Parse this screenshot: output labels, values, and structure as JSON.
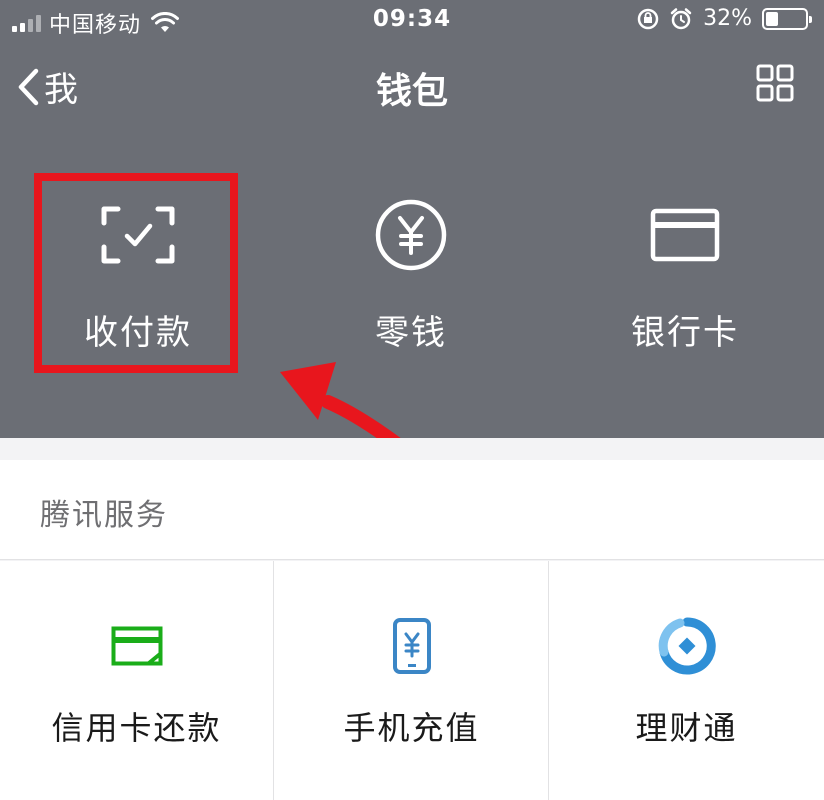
{
  "status_bar": {
    "carrier": "中国移动",
    "time": "09:34",
    "battery_percent": "32%",
    "battery_level": 0.32,
    "signal_bars": 4,
    "signal_bars_active": 2
  },
  "navbar": {
    "back_label": "我",
    "title": "钱包"
  },
  "wallet": {
    "items": [
      {
        "label": "收付款",
        "icon": "scan-check-icon"
      },
      {
        "label": "零钱",
        "icon": "yuan-coin-icon"
      },
      {
        "label": "银行卡",
        "icon": "bank-card-icon"
      }
    ]
  },
  "tencent_services": {
    "title": "腾讯服务",
    "items": [
      {
        "label": "信用卡还款",
        "icon": "credit-card-icon",
        "color": "#1aad19"
      },
      {
        "label": "手机充值",
        "icon": "phone-recharge-icon",
        "color": "#3b86c6"
      },
      {
        "label": "理财通",
        "icon": "wealth-icon",
        "color": "#2f8fd6"
      }
    ]
  },
  "colors": {
    "header_bg": "#6b6e75",
    "highlight": "#e8161d",
    "content_bg": "#f3f3f5"
  }
}
